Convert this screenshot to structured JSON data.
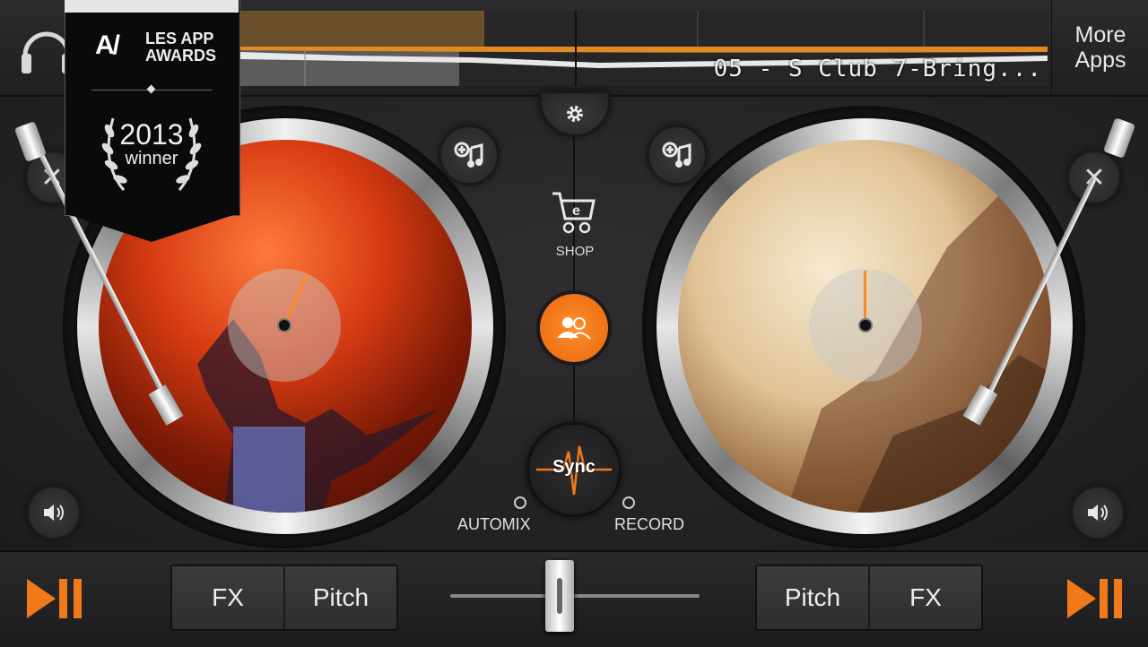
{
  "top_bar": {
    "track_title": "05 - S Club 7-Bring...",
    "more_apps_label": "More\nApps"
  },
  "badge": {
    "logo_text": "A/",
    "name": "LES APP\nAWARDS",
    "year": "2013",
    "winner_label": "winner"
  },
  "center": {
    "shop_label": "SHOP",
    "sync_label": "Sync",
    "automix_label": "AUTOMIX",
    "record_label": "RECORD"
  },
  "left_deck": {
    "fx_label": "FX",
    "pitch_label": "Pitch"
  },
  "right_deck": {
    "pitch_label": "Pitch",
    "fx_label": "FX"
  },
  "crossfader": {
    "position": 0.44
  },
  "colors": {
    "accent": "#f07a1a",
    "background": "#1f1f21"
  },
  "icons": [
    "headphone-icon",
    "settings-icon",
    "add-music-icon",
    "shop-cart-icon",
    "community-icon",
    "volume-icon",
    "play-pause-icon"
  ]
}
